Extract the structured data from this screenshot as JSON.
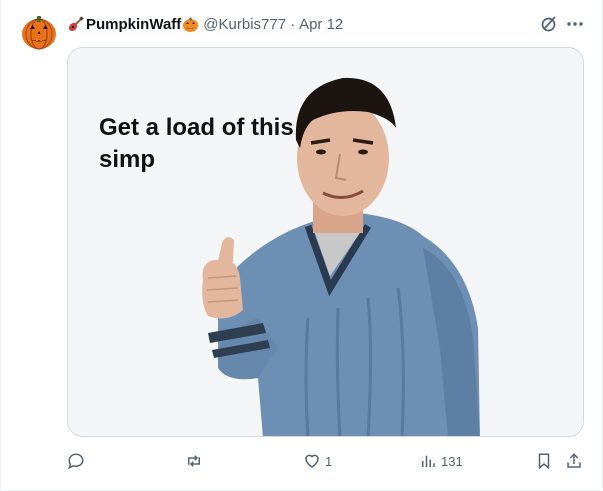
{
  "tweet": {
    "display_name": "PumpkinWaff",
    "handle": "@Kurbis777",
    "separator": "·",
    "date": "Apr 12",
    "media_caption": "Get a load of this simp",
    "actions": {
      "reply_count": "",
      "repost_count": "",
      "like_count": "1",
      "views_count": "131"
    }
  },
  "icons": {
    "avatar": "jack-o-lantern-avatar",
    "name_prefix": "guitar-icon",
    "name_suffix": "pumpkin-emoji-icon",
    "grok": "grok-icon",
    "more": "more-icon",
    "reply": "reply-icon",
    "repost": "repost-icon",
    "like": "heart-icon",
    "views": "views-icon",
    "bookmark": "bookmark-icon",
    "share": "share-icon"
  },
  "colors": {
    "text_primary": "#0f1419",
    "text_secondary": "#536471",
    "border": "#cfd9de",
    "pumpkin": "#e8731a"
  }
}
